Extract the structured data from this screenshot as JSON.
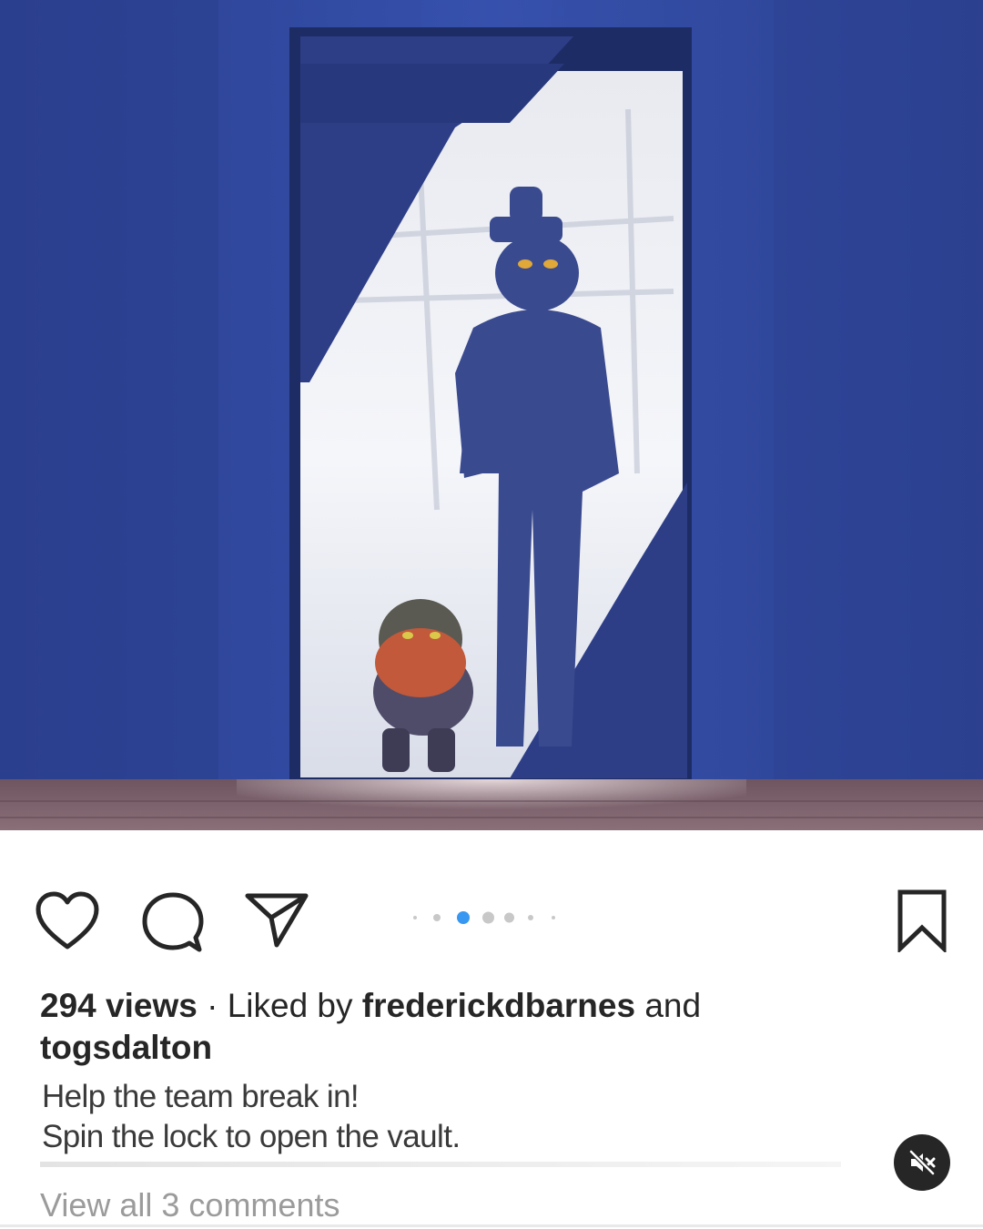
{
  "post": {
    "views_text": "294 views",
    "separator": " · ",
    "liked_by_prefix": "Liked by ",
    "liked_by_user": "frederickdbarnes",
    "and_text": " and",
    "second_user": "togsdalton",
    "caption_line_1": "Help the team break in!",
    "caption_line_2": "Spin the lock to open the vault.",
    "view_all_comments": "View all 3 comments"
  },
  "carousel": {
    "total_dots": 7,
    "active_index": 2
  },
  "icons": {
    "like": "heart-icon",
    "comment": "comment-bubble-icon",
    "share": "paper-plane-icon",
    "save": "bookmark-icon",
    "mute": "speaker-muted-icon"
  },
  "colors": {
    "active_dot": "#3897f0",
    "inactive_dot": "#c8c8c8",
    "text": "#262626",
    "muted_text": "#9b9b9b"
  }
}
